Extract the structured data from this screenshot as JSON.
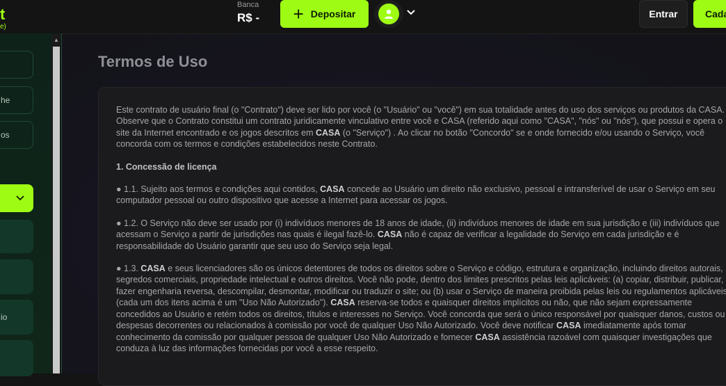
{
  "header": {
    "logo_mark": "t",
    "logo_sub": "e)",
    "balance_label": "Banca",
    "balance_value": "R$  -",
    "deposit_icon": "plus-icon",
    "deposit_label": "Depositar",
    "avatar_icon": "user-icon",
    "menu_icon": "chevron-down-icon",
    "login_label": "Entrar",
    "register_label": "Cada"
  },
  "sidebar": {
    "items": [
      {
        "label": ""
      },
      {
        "label": "he"
      },
      {
        "label": "os"
      },
      {
        "label": ""
      },
      {
        "label": ""
      },
      {
        "label": ""
      },
      {
        "label": "io"
      },
      {
        "label": ""
      }
    ],
    "active_icon": "chevron-down-icon",
    "scroll_icon": "triangle-up-icon"
  },
  "page": {
    "title": "Termos de Uso",
    "intro": "Este contrato de usuário final (o \"Contrato\") deve ser lido por você (o \"Usuário\" ou \"você\") em sua totalidade antes do uso dos serviços ou produtos da CASA. Observe que o Contrato constitui um contrato juridicamente vinculativo entre você e CASA (referido aqui como \"CASA\", \"nós\" ou \"nós\"), que possui e opera o site da Internet encontrado e os jogos descritos em",
    "intro_bold": "CASA",
    "intro_end": "(o \"Serviço\") . Ao clicar no botão \"Concordo\" se e onde fornecido e/ou usando o Serviço, você concorda com os termos e condições estabelecidos neste Contrato.",
    "section_heading": "1. Concessão de licença",
    "c11_a": "● 1.1. Sujeito aos termos e condições aqui contidos,",
    "c11_b": "CASA",
    "c11_c": "concede ao Usuário um direito não exclusivo, pessoal e intransferível de usar o Serviço em seu computador pessoal ou outro dispositivo que acesse a Internet para acessar os jogos.",
    "c12_a": "● 1.2. O Serviço não deve ser usado por (i) indivíduos menores de 18 anos de idade, (ii) indivíduos menores de idade em sua jurisdição e (iii) indivíduos que acessam o Serviço a partir de jurisdições nas quais é ilegal fazê-lo.",
    "c12_b": "CASA",
    "c12_c": "não é capaz de verificar a legalidade do Serviço em cada jurisdição e é responsabilidade do Usuário garantir que seu uso do Serviço seja legal.",
    "c13_a": "● 1.3.",
    "c13_b": "CASA",
    "c13_c": "e seus licenciadores são os únicos detentores de todos os direitos sobre o Serviço e código, estrutura e organização, incluindo direitos autorais, segredos comerciais, propriedade intelectual e outros direitos. Você não pode, dentro dos limites prescritos pelas leis aplicáveis: (a) copiar, distribuir, publicar, fazer engenharia reversa, descompilar, desmontar, modificar ou traduzir o site; ou (b) usar o Serviço de maneira proibida pelas leis ou regulamentos aplicáveis (cada um dos itens acima é um \"Uso Não Autorizado\").",
    "c13_d": "CASA",
    "c13_e": "reserva-se todos e quaisquer direitos implícitos ou não, que não sejam expressamente concedidos ao Usuário e retém todos os direitos, títulos e interesses no Serviço. Você concorda que será o único responsável por quaisquer danos, custos ou despesas decorrentes ou relacionados à comissão por você de qualquer Uso Não Autorizado. Você deve notificar",
    "c13_f": "CASA",
    "c13_g": "imediatamente após tomar conhecimento da comissão por qualquer pessoa de qualquer Uso Não Autorizado e fornecer",
    "c13_h": "CASA",
    "c13_i": "assistência razoável com quaisquer investigações que conduza à luz das informações fornecidas por você a esse respeito."
  },
  "colors": {
    "accent": "#9efc14",
    "background": "#141414",
    "sidebar": "#0e2219"
  }
}
